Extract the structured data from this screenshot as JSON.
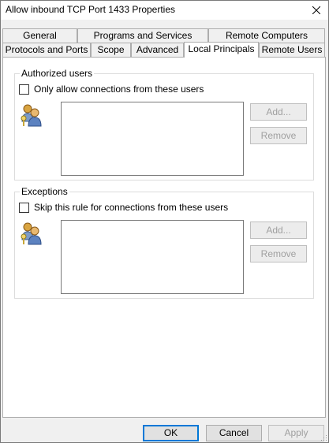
{
  "window": {
    "title": "Allow inbound TCP Port 1433 Properties"
  },
  "tabs_back": [
    {
      "label": "General"
    },
    {
      "label": "Programs and Services"
    },
    {
      "label": "Remote Computers"
    }
  ],
  "tabs_front": [
    {
      "label": "Protocols and Ports"
    },
    {
      "label": "Scope"
    },
    {
      "label": "Advanced"
    },
    {
      "label": "Local Principals",
      "active": true
    },
    {
      "label": "Remote Users"
    }
  ],
  "authorized": {
    "legend": "Authorized users",
    "checkbox_label": "Only allow connections from these users",
    "checked": false,
    "add_label": "Add...",
    "remove_label": "Remove",
    "icon": "users-icon"
  },
  "exceptions": {
    "legend": "Exceptions",
    "checkbox_label": "Skip this rule for connections from these users",
    "checked": false,
    "add_label": "Add...",
    "remove_label": "Remove",
    "icon": "users-icon"
  },
  "buttons": {
    "ok": "OK",
    "cancel": "Cancel",
    "apply": "Apply"
  },
  "colors": {
    "accent": "#0078d7",
    "disabled_text": "#a0a0a0"
  }
}
